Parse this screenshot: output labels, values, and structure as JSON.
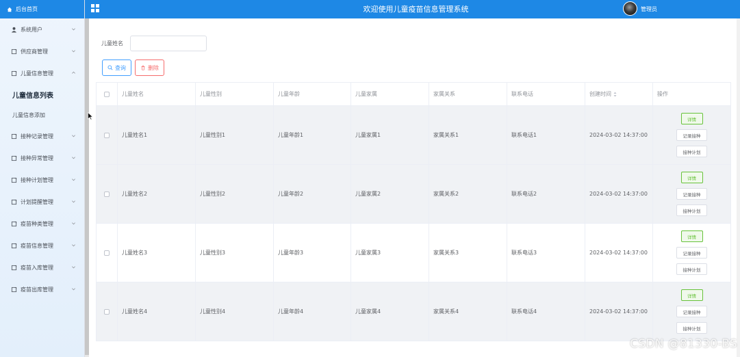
{
  "app": {
    "title": "欢迎使用儿童疫苗信息管理系统",
    "user_name": "管理员",
    "colors": {
      "primary": "#1e88e5",
      "success": "#67c23a",
      "danger": "#f56c6c",
      "accent": "#409eff"
    }
  },
  "sidebar": {
    "home_label": "后台首页",
    "items": [
      {
        "label": "系统用户",
        "icon": "user-icon"
      },
      {
        "label": "供应商管理",
        "icon": "document-icon"
      },
      {
        "label": "儿童信息管理",
        "icon": "document-icon",
        "expanded": true,
        "children": [
          {
            "label": "儿童信息列表",
            "active": true
          },
          {
            "label": "儿童信息添加",
            "active": false
          }
        ]
      },
      {
        "label": "接种记录管理",
        "icon": "document-icon"
      },
      {
        "label": "接种异常管理",
        "icon": "document-icon"
      },
      {
        "label": "接种计划管理",
        "icon": "document-icon"
      },
      {
        "label": "计划提醒管理",
        "icon": "document-icon"
      },
      {
        "label": "疫苗种类管理",
        "icon": "document-icon"
      },
      {
        "label": "疫苗信息管理",
        "icon": "document-icon"
      },
      {
        "label": "疫苗入库管理",
        "icon": "document-icon"
      },
      {
        "label": "疫苗出库管理",
        "icon": "document-icon"
      }
    ]
  },
  "filter": {
    "label": "儿童姓名",
    "value": "",
    "search_label": "查询",
    "delete_label": "删除"
  },
  "table": {
    "columns": [
      "儿童姓名",
      "儿童性别",
      "儿童年龄",
      "儿童家属",
      "家属关系",
      "联系电话",
      "创建时间",
      "操作"
    ],
    "rows": [
      {
        "name": "儿童姓名1",
        "gender": "儿童性别1",
        "age": "儿童年龄1",
        "family": "儿童家属1",
        "relation": "家属关系1",
        "phone": "联系电话1",
        "created": "2024-03-02 14:37:00"
      },
      {
        "name": "儿童姓名2",
        "gender": "儿童性别2",
        "age": "儿童年龄2",
        "family": "儿童家属2",
        "relation": "家属关系2",
        "phone": "联系电话2",
        "created": "2024-03-02 14:37:00"
      },
      {
        "name": "儿童姓名3",
        "gender": "儿童性别3",
        "age": "儿童年龄3",
        "family": "儿童家属3",
        "relation": "家属关系3",
        "phone": "联系电话3",
        "created": "2024-03-02 14:37:00"
      },
      {
        "name": "儿童姓名4",
        "gender": "儿童性别4",
        "age": "儿童年龄4",
        "family": "儿童家属4",
        "relation": "家属关系4",
        "phone": "联系电话4",
        "created": "2024-03-02 14:37:00"
      }
    ],
    "actions": {
      "detail": "详情",
      "record": "记录接种",
      "plan": "接种计划"
    }
  },
  "watermark": "CSDN @81330-BS"
}
